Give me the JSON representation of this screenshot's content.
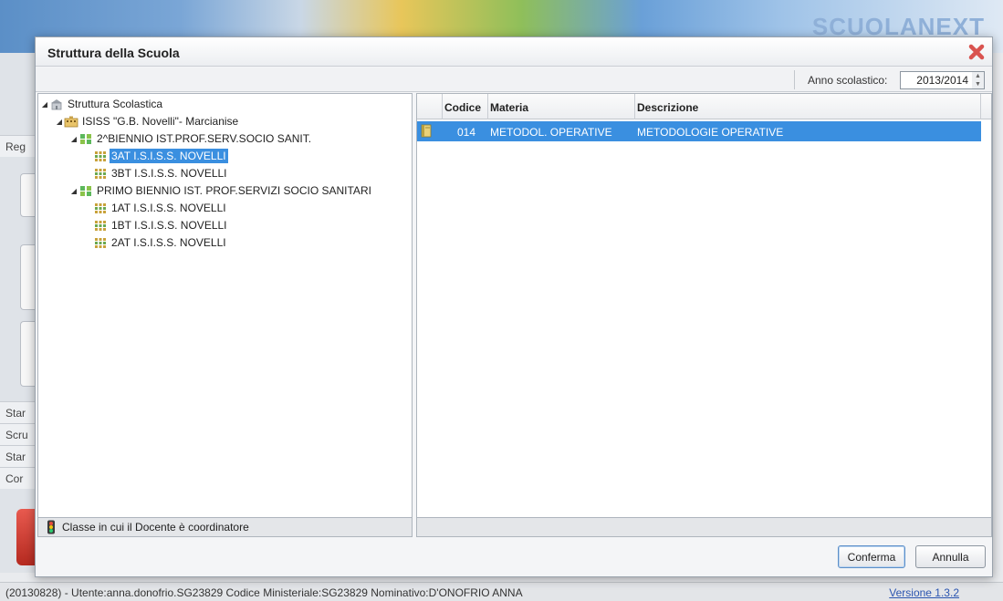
{
  "background": {
    "logo_right": "SCUOLANEXT",
    "left_tabs": [
      "Reg",
      "Star",
      "Scru",
      "Star",
      "Cor"
    ]
  },
  "dialog": {
    "title": "Struttura della Scuola",
    "school_year": {
      "label": "Anno scolastico:",
      "value": "2013/2014"
    },
    "tree": {
      "nodes": [
        {
          "label": "Struttura Scolastica",
          "icon": "school-building-icon",
          "level": 0
        },
        {
          "label": "ISISS \"G.B. Novelli\"- Marcianise",
          "icon": "institute-icon",
          "level": 1
        },
        {
          "label": "2^BIENNIO IST.PROF.SERV.SOCIO SANIT.",
          "icon": "course-icon",
          "level": 2
        },
        {
          "label": "3AT I.S.I.S.S. NOVELLI",
          "icon": "class-icon",
          "level": 3,
          "selected": true
        },
        {
          "label": "3BT I.S.I.S.S. NOVELLI",
          "icon": "class-icon",
          "level": 3
        },
        {
          "label": "PRIMO BIENNIO IST. PROF.SERVIZI SOCIO SANITARI",
          "icon": "course-icon",
          "level": 2
        },
        {
          "label": "1AT I.S.I.S.S. NOVELLI",
          "icon": "class-icon",
          "level": 3
        },
        {
          "label": "1BT I.S.I.S.S. NOVELLI",
          "icon": "class-icon",
          "level": 3
        },
        {
          "label": "2AT I.S.I.S.S. NOVELLI",
          "icon": "class-icon",
          "level": 3
        }
      ],
      "legend": "Classe in cui il Docente è coordinatore"
    },
    "table": {
      "headers": [
        "",
        "Codice",
        "Materia",
        "Descrizione"
      ],
      "rows": [
        {
          "icon": "book-icon",
          "codice": "014",
          "materia": "METODOL. OPERATIVE",
          "descrizione": "METODOLOGIE OPERATIVE",
          "selected": true
        }
      ]
    },
    "buttons": {
      "confirm": "Conferma",
      "cancel": "Annulla"
    }
  },
  "status_bar": {
    "text": "(20130828) - Utente:anna.donofrio.SG23829 Codice Ministeriale:SG23829 Nominativo:D'ONOFRIO ANNA",
    "version": "Versione 1.3.2"
  },
  "colors": {
    "selection": "#3a8fe0",
    "close_button": "#d9534f",
    "link": "#2b55b0"
  }
}
